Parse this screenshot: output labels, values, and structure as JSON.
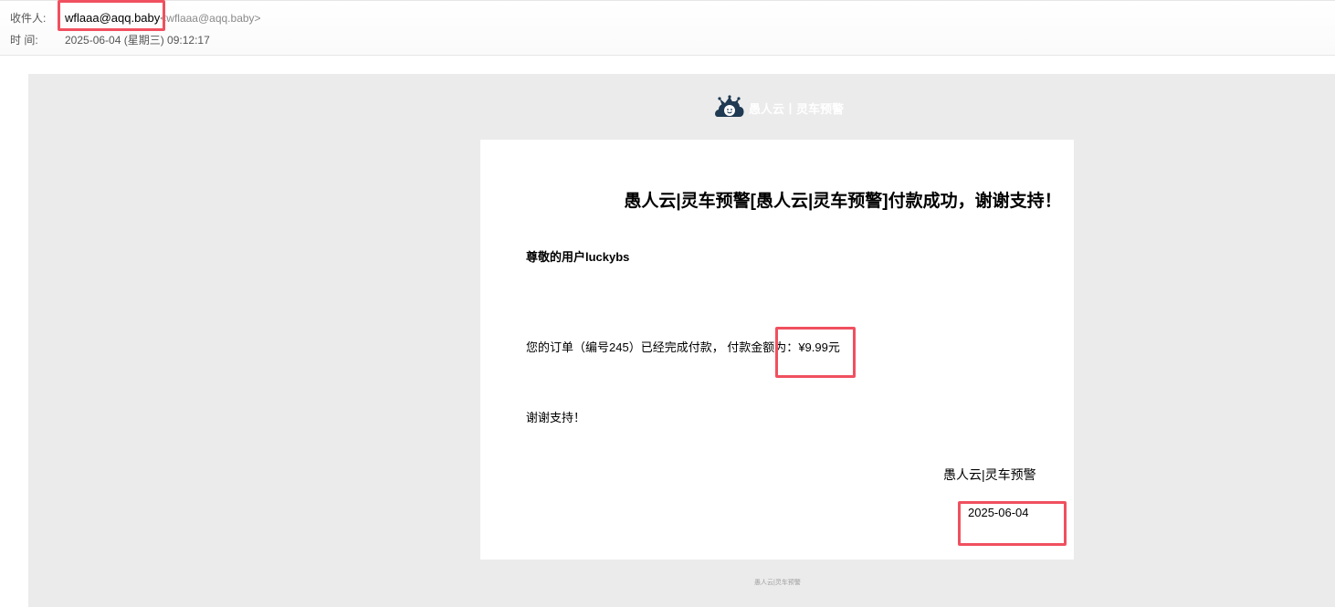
{
  "header": {
    "to_label": "收件人:",
    "to_name": "wflaaa@aqq.baby",
    "to_address": "<wflaaa@aqq.baby>",
    "time_label": "时 间:",
    "time_value": "2025-06-04 (星期三) 09:12:17"
  },
  "brand": {
    "name": "愚人云丨灵车预警",
    "logo_icon": "jester-cloud-icon"
  },
  "email": {
    "title": "愚人云|灵车预警[愚人云|灵车预警]付款成功，谢谢支持！",
    "greeting": "尊敬的用户luckybs",
    "body_prefix": "您的订单（编号245）已经完成付款，  付款金额为：",
    "amount": "¥9.99元",
    "thanks": "谢谢支持！",
    "signature": "愚人云|灵车预警",
    "signature_date": "2025-06-04",
    "footer": "愚人云|灵车预警"
  },
  "highlight": {
    "color": "#f0505f"
  }
}
